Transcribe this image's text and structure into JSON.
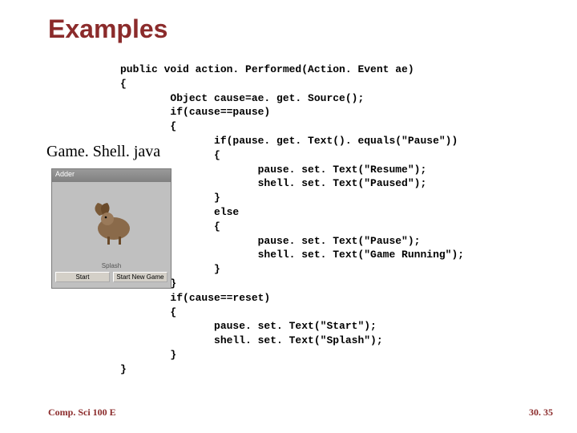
{
  "title": "Examples",
  "file_label": "Game. Shell. java",
  "footer": {
    "left": "Comp. Sci 100 E",
    "right": "30. 35"
  },
  "app_window": {
    "title": "Adder",
    "label": "Splash",
    "buttons": {
      "left": "Start",
      "right": "Start New Game"
    }
  },
  "code": "public void action. Performed(Action. Event ae)\n{\n        Object cause=ae. get. Source();\n        if(cause==pause)\n        {\n               if(pause. get. Text(). equals(\"Pause\"))\n               {\n                      pause. set. Text(\"Resume\");\n                      shell. set. Text(\"Paused\");\n               }\n               else\n               {\n                      pause. set. Text(\"Pause\");\n                      shell. set. Text(\"Game Running\");\n               }\n        }\n        if(cause==reset)\n        {\n               pause. set. Text(\"Start\");\n               shell. set. Text(\"Splash\");\n        }\n}"
}
